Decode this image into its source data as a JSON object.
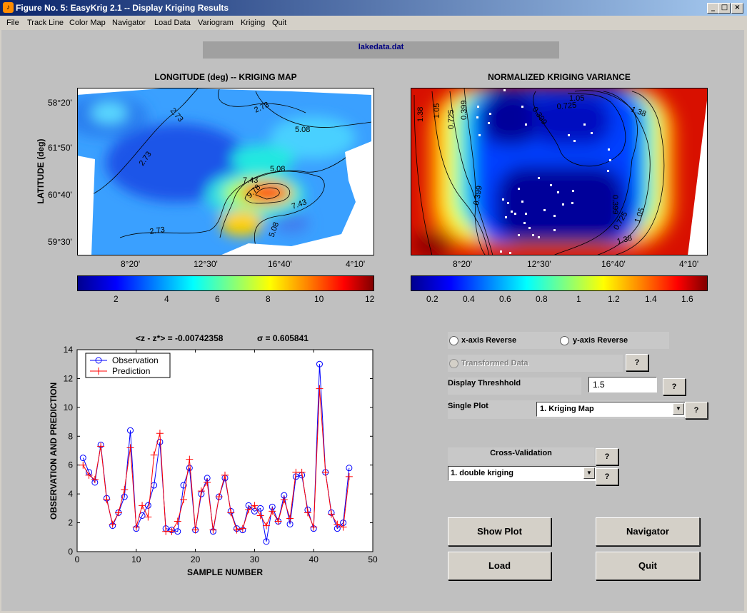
{
  "window": {
    "title": "Figure No. 5: EasyKrig 2.1 -- Display Kriging Results",
    "minimize": "_",
    "maximize": "□",
    "close": "×"
  },
  "menu": [
    "File",
    "Track Line",
    "Color Map",
    "Navigator",
    "Load Data",
    "Variogram",
    "Kriging",
    "Quit"
  ],
  "filename": "lakedata.dat",
  "map_left": {
    "title": "LONGITUDE (deg) -- KRIGING MAP",
    "ylabel": "LATITUDE (deg)",
    "yticks": [
      "58°20'",
      "61°50'",
      "60°40'",
      "59°30'"
    ],
    "xticks": [
      "8°20'",
      "12°30'",
      "16°40'",
      "4°10'"
    ],
    "contour_labels": [
      "2.73",
      "2.73",
      "2.73",
      "2.73",
      "5.08",
      "5.08",
      "5.08",
      "7.43",
      "9.78",
      "7.43"
    ],
    "colorbar_ticks": [
      "2",
      "4",
      "6",
      "8",
      "10",
      "12"
    ]
  },
  "map_right": {
    "title": "NORMALIZED KRIGING VARIANCE",
    "xticks": [
      "8°20'",
      "12°30'",
      "16°40'",
      "4°10'"
    ],
    "contour_labels": [
      "1.38",
      "1.05",
      "0.725",
      "0.399",
      "1.05",
      "0.725",
      "0.399",
      "1.38",
      "0.399",
      "0.399",
      "0.725",
      "1.05",
      "1.38"
    ],
    "colorbar_ticks": [
      "0.2",
      "0.4",
      "0.6",
      "0.8",
      "1",
      "1.2",
      "1.4",
      "1.6"
    ]
  },
  "stats": {
    "left": "<z - z*> = -0.00742358",
    "right": "σ = 0.605841"
  },
  "chart_data": {
    "type": "line",
    "xlabel": "SAMPLE NUMBER",
    "ylabel": "OBSERVATION AND PREDICTION",
    "xlim": [
      0,
      50
    ],
    "ylim": [
      0,
      14
    ],
    "xticks": [
      "0",
      "10",
      "20",
      "30",
      "40",
      "50"
    ],
    "yticks": [
      "0",
      "2",
      "4",
      "6",
      "8",
      "10",
      "12",
      "14"
    ],
    "legend_position": "top-left",
    "x": [
      1,
      2,
      3,
      4,
      5,
      6,
      7,
      8,
      9,
      10,
      11,
      12,
      13,
      14,
      15,
      16,
      17,
      18,
      19,
      20,
      21,
      22,
      23,
      24,
      25,
      26,
      27,
      28,
      29,
      30,
      31,
      32,
      33,
      34,
      35,
      36,
      37,
      38,
      39,
      40,
      41,
      42,
      43,
      44,
      45,
      46
    ],
    "series": [
      {
        "name": "Observation",
        "color": "#0000ff",
        "marker": "circle",
        "values": [
          6.5,
          5.5,
          4.8,
          7.4,
          3.7,
          1.8,
          2.7,
          3.8,
          8.4,
          1.6,
          2.5,
          3.2,
          4.6,
          7.6,
          1.6,
          1.5,
          1.4,
          4.6,
          5.8,
          1.5,
          4.0,
          5.1,
          1.4,
          3.8,
          5.1,
          2.8,
          1.6,
          1.5,
          3.2,
          2.8,
          3.0,
          0.7,
          3.1,
          2.1,
          3.9,
          1.9,
          5.2,
          5.3,
          2.9,
          1.6,
          13.0,
          5.5,
          2.7,
          1.6,
          2.0,
          5.8
        ]
      },
      {
        "name": "Prediction",
        "color": "#ff0000",
        "marker": "plus",
        "values": [
          6.0,
          5.3,
          5.0,
          7.3,
          3.6,
          1.9,
          2.7,
          4.3,
          7.2,
          1.7,
          3.2,
          2.4,
          6.7,
          8.2,
          1.4,
          1.4,
          2.1,
          3.6,
          6.4,
          1.5,
          4.2,
          4.8,
          1.5,
          3.8,
          5.3,
          2.7,
          1.5,
          1.6,
          2.9,
          3.2,
          2.5,
          1.8,
          2.8,
          2.1,
          3.6,
          2.3,
          5.5,
          5.5,
          2.7,
          1.7,
          11.3,
          5.5,
          2.6,
          1.9,
          1.7,
          5.2
        ]
      }
    ]
  },
  "controls": {
    "xreverse": "x-axis Reverse",
    "yreverse": "y-axis Reverse",
    "transformed": "Transformed Data",
    "threshold_label": "Display Threshhold",
    "threshold_value": "1.5",
    "single_plot_label": "Single Plot",
    "single_plot_value": "1.  Kriging Map",
    "crossval_label": "Cross-Validation",
    "crossval_value": "1.  double kriging",
    "help": "?",
    "show_plot": "Show Plot",
    "navigator": "Navigator",
    "load": "Load",
    "quit": "Quit"
  },
  "colors": {
    "titlebar": "#0a246a",
    "observation": "#0000ff",
    "prediction": "#ff0000"
  }
}
